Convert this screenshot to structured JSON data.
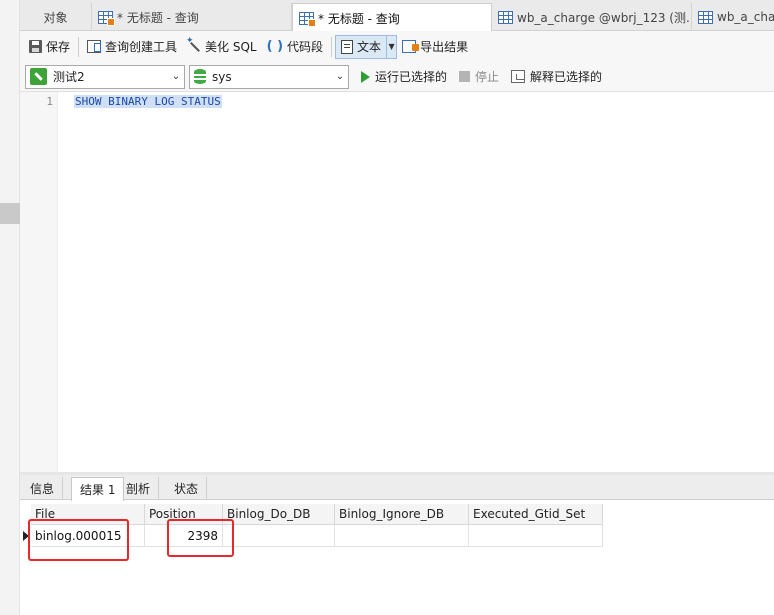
{
  "tabs": [
    {
      "label": "对象"
    },
    {
      "label": "* 无标题 - 查询"
    },
    {
      "label": "* 无标题 - 查询"
    },
    {
      "label": "wb_a_charge @wbrj_123 (测..."
    },
    {
      "label": "wb_a_char"
    }
  ],
  "toolbar": {
    "save": "保存",
    "query_builder": "查询创建工具",
    "beautify": "美化 SQL",
    "snippet": "代码段",
    "text": "文本",
    "export": "导出结果"
  },
  "connection": {
    "selected": "测试2",
    "database": "sys",
    "run_selected": "运行已选择的",
    "stop": "停止",
    "explain_selected": "解释已选择的"
  },
  "editor": {
    "line_number": "1",
    "sql": "SHOW BINARY LOG STATUS"
  },
  "results": {
    "tabs": [
      "信息",
      "结果 1",
      "剖析",
      "状态"
    ],
    "active_tab": "结果 1",
    "columns": [
      "File",
      "Position",
      "Binlog_Do_DB",
      "Binlog_Ignore_DB",
      "Executed_Gtid_Set"
    ],
    "rows": [
      [
        "binlog.000015",
        "2398",
        "",
        "",
        ""
      ]
    ]
  },
  "colors": {
    "highlight_box": "#e8282a",
    "sql_keyword": "#1c47a8",
    "selection": "#cfe0f5",
    "accent_blue": "#3d6fb4",
    "run_green": "#2f9e39"
  }
}
